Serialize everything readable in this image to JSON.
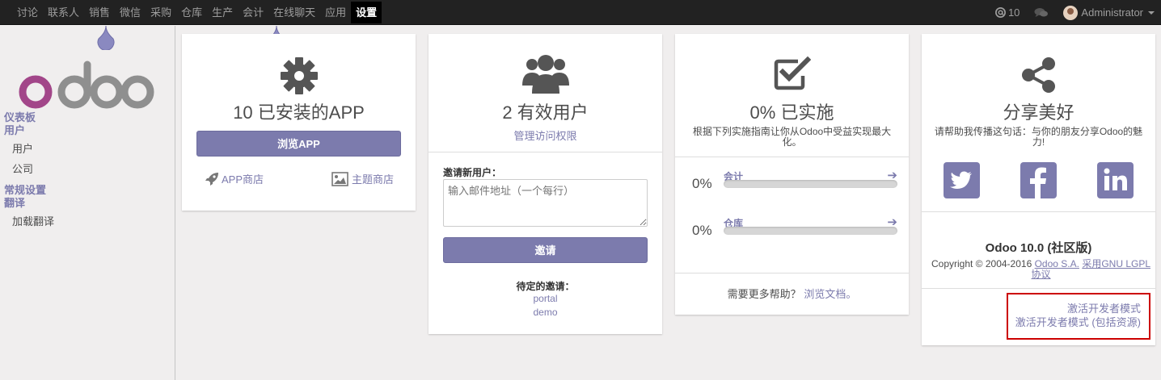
{
  "topbar": {
    "menu": [
      "讨论",
      "联系人",
      "销售",
      "微信",
      "采购",
      "仓库",
      "生产",
      "会计",
      "在线聊天",
      "应用",
      "设置"
    ],
    "active_index": 10,
    "mentions": "10",
    "user": "Administrator"
  },
  "sidebar": {
    "dashboard": "仪表板",
    "users_head": "用户",
    "users": "用户",
    "companies": "公司",
    "general_settings": "常规设置",
    "translations_head": "翻译",
    "load_translation": "加载翻译"
  },
  "apps_card": {
    "title": "10 已安装的APP",
    "browse_button": "浏览APP",
    "app_store": "APP商店",
    "theme_store": "主题商店"
  },
  "users_card": {
    "title": "2 有效用户",
    "manage_link": "管理访问权限",
    "invite_label": "邀请新用户：",
    "email_placeholder": "输入邮件地址（一个每行）",
    "invite_button": "邀请",
    "pending_label": "待定的邀请：",
    "pending": [
      "portal",
      "demo"
    ]
  },
  "impl_card": {
    "title": "0% 已实施",
    "subtitle": "根据下列实施指南让你从Odoo中受益实现最大化。",
    "steps": [
      {
        "pct_label": "0%",
        "name": "会计",
        "progress": 0
      },
      {
        "pct_label": "0%",
        "name": "仓库",
        "progress": 0
      }
    ],
    "help_text": "需要更多帮助？",
    "help_link": "浏览文档。"
  },
  "share_card": {
    "title": "分享美好",
    "subtitle": "请帮助我传播这句话：与你的朋友分享Odoo的魅力!",
    "version": "Odoo 10.0 (社区版)",
    "copyright": "Copyright © 2004-2016",
    "company_link": "Odoo S.A.",
    "license_link": "采用GNU LGPL协议",
    "dev_mode": "激活开发者模式",
    "dev_mode_assets": "激活开发者模式 (包括资源)"
  },
  "colors": {
    "accent": "#7c7bad",
    "topbar": "#222222",
    "highlight_border": "#cc0000"
  }
}
